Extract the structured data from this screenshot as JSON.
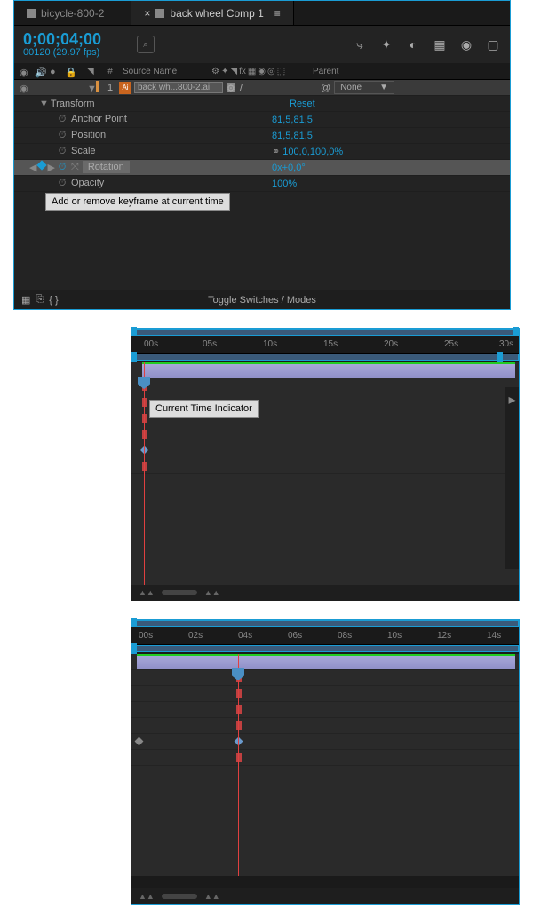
{
  "tabs": [
    {
      "label": "bicycle-800-2",
      "active": false
    },
    {
      "label": "back wheel Comp 1",
      "active": true
    }
  ],
  "timecode": "0;00;04;00",
  "framerate": "00120 (29.97 fps)",
  "cols": {
    "hash": "#",
    "source": "Source Name",
    "parent": "Parent"
  },
  "layer": {
    "num": "1",
    "name": "back wh...800-2.ai",
    "parent": "None"
  },
  "transform": {
    "label": "Transform",
    "reset": "Reset",
    "anchor_l": "Anchor Point",
    "anchor_v": "81,5,81,5",
    "pos_l": "Position",
    "pos_v": "81,5,81,5",
    "scale_l": "Scale",
    "scale_v": "100,0,100,0%",
    "rot_l": "Rotation",
    "rot_v": "0x+0,0°",
    "opacity_l": "Opacity",
    "opacity_v": "100%"
  },
  "tooltip_kf": "Add or remove keyframe at current time",
  "toggle": "Toggle Switches / Modes",
  "tl1": {
    "ticks": [
      "00s",
      "05s",
      "10s",
      "15s",
      "20s",
      "25s",
      "30s"
    ],
    "tooltip": "Current Time Indicator",
    "cti_pct": 3
  },
  "tl2": {
    "ticks": [
      "00s",
      "02s",
      "04s",
      "06s",
      "08s",
      "10s",
      "12s",
      "14s"
    ],
    "cti_pct": 28
  }
}
